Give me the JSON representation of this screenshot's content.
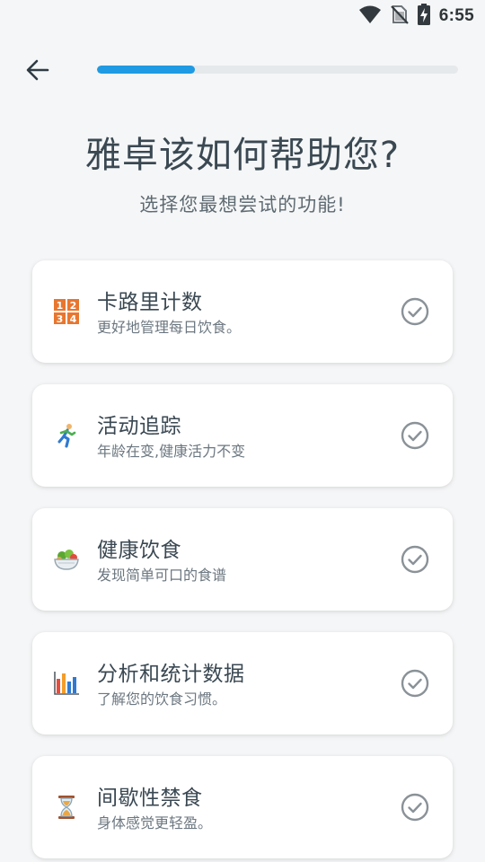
{
  "status_bar": {
    "time": "6:55",
    "icons": [
      "wifi-icon",
      "no-sim-icon",
      "battery-charging-icon"
    ]
  },
  "header": {
    "back_icon": "arrow-left-icon",
    "progress_fraction": 0.27,
    "progress_color": "#1f9ae3"
  },
  "title": "雅卓该如何帮助您?",
  "subtitle": "选择您最想尝试的功能!",
  "options": [
    {
      "icon": "input-numbers-icon",
      "title": "卡路里计数",
      "description": "更好地管理每日饮食。",
      "selected": false
    },
    {
      "icon": "runner-icon",
      "title": "活动追踪",
      "description": "年龄在变,健康活力不变",
      "selected": false
    },
    {
      "icon": "salad-icon",
      "title": "健康饮食",
      "description": "发现简单可口的食谱",
      "selected": false
    },
    {
      "icon": "bar-chart-icon",
      "title": "分析和统计数据",
      "description": "了解您的饮食习惯。",
      "selected": false
    },
    {
      "icon": "hourglass-icon",
      "title": "间歇性禁食",
      "description": "身体感觉更轻盈。",
      "selected": false
    }
  ]
}
